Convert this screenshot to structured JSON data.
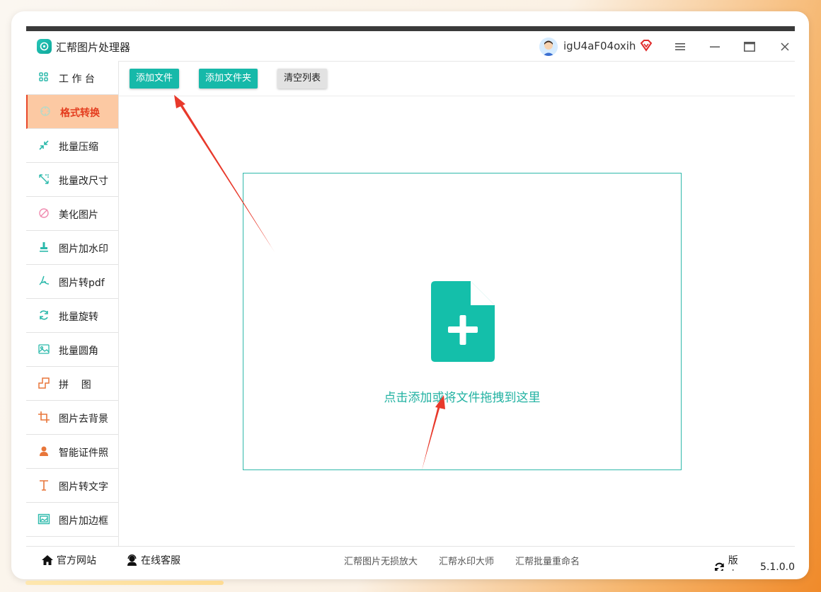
{
  "app": {
    "title": "汇帮图片处理器",
    "username": "igU4aF04oxih",
    "brand_color": "#16b9a9"
  },
  "window_controls": {
    "menu_icon": "hamburger-icon",
    "minimize_icon": "minimize-icon",
    "maximize_icon": "maximize-icon",
    "close_icon": "close-icon"
  },
  "sidebar": {
    "items": [
      {
        "label": "工 作 台",
        "icon": "grid-icon"
      },
      {
        "label": "格式转换",
        "icon": "convert-icon",
        "active": true
      },
      {
        "label": "批量压缩",
        "icon": "compress-icon"
      },
      {
        "label": "批量改尺寸",
        "icon": "resize-icon"
      },
      {
        "label": "美化图片",
        "icon": "beautify-icon"
      },
      {
        "label": "图片加水印",
        "icon": "watermark-icon"
      },
      {
        "label": "图片转pdf",
        "icon": "pdf-icon"
      },
      {
        "label": "批量旋转",
        "icon": "rotate-icon"
      },
      {
        "label": "批量圆角",
        "icon": "rounded-corner-icon"
      },
      {
        "label": "拼    图",
        "icon": "collage-icon"
      },
      {
        "label": "图片去背景",
        "icon": "crop-icon"
      },
      {
        "label": "智能证件照",
        "icon": "person-icon"
      },
      {
        "label": "图片转文字",
        "icon": "text-icon"
      },
      {
        "label": "图片加边框",
        "icon": "frame-icon"
      }
    ]
  },
  "toolbar": {
    "add_file": "添加文件",
    "add_folder": "添加文件夹",
    "clear_list": "清空列表"
  },
  "dropzone": {
    "text": "点击添加或将文件拖拽到这里",
    "icon": "file-add-icon"
  },
  "statusbar": {
    "website": "官方网站",
    "support": "在线客服",
    "links": [
      "汇帮图片无损放大",
      "汇帮水印大师",
      "汇帮批量重命名"
    ],
    "version_label": "版本：",
    "version": "5.1.0.0"
  },
  "annotation_color": "#e8392b"
}
